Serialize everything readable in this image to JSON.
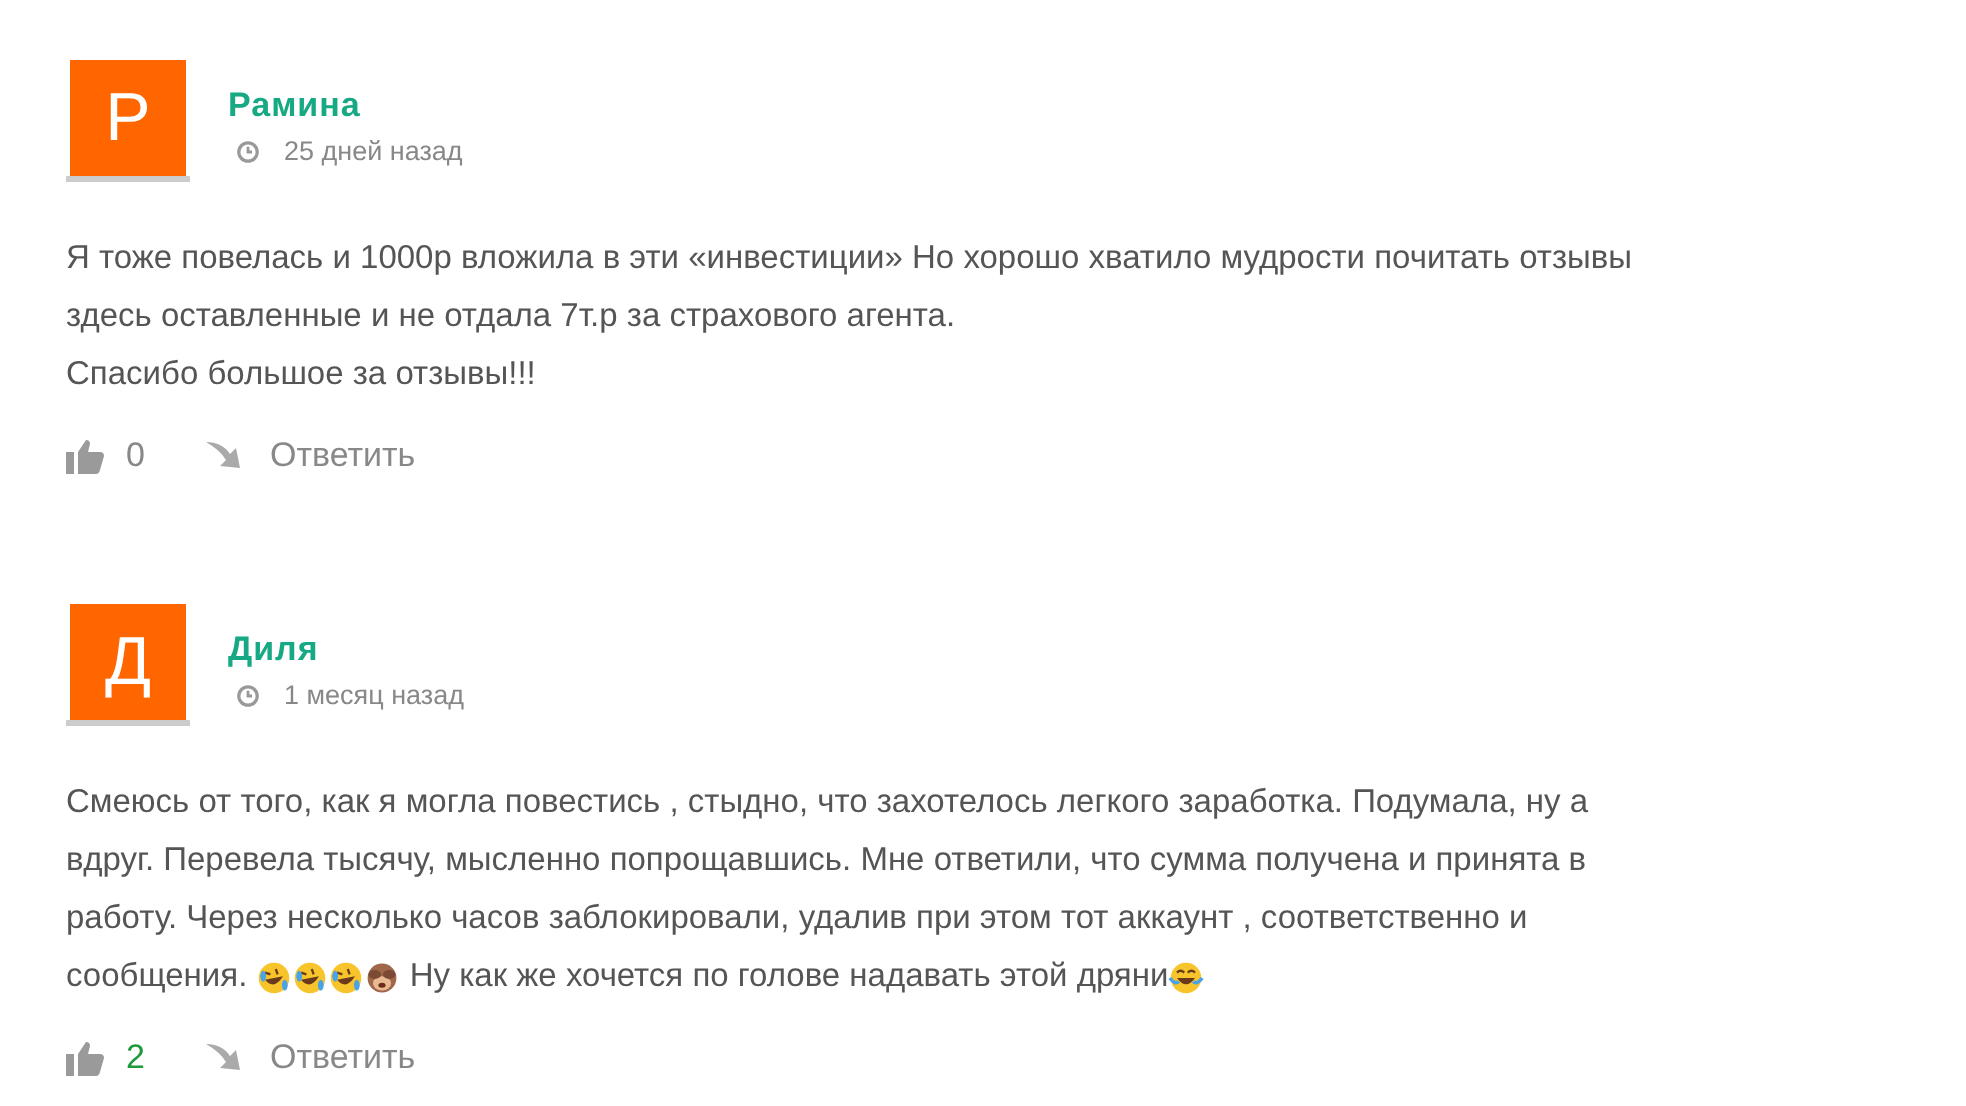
{
  "comments": [
    {
      "initial": "Р",
      "author": "Рамина",
      "date": "25 дней назад",
      "lines": [
        "Я тоже повелась и 1000р вложила в эти «инвестиции» Но хорошо хватило мудрости почитать отзывы",
        "здесь оставленные и не отдала 7т.р за страхового агента.",
        "Спасибо большое за отзывы!!!"
      ],
      "likes": {
        "count": "0",
        "color": "#888888"
      },
      "reply": "Ответить"
    },
    {
      "initial": "Д",
      "author": "Диля",
      "date": "1 месяц назад",
      "lines": [
        "Смеюсь от того, как я могла повестись , стыдно, что захотелось легкого заработка. Подумала, ну а",
        "вдруг. Перевела тысячу, мысленно попрощавшись. Мне ответили, что сумма получена и принята в",
        "работу. Через несколько часов заблокировали, удалив при этом тот аккаунт , соответственно и",
        [
          {
            "kind": "text",
            "value": "сообщения. "
          },
          {
            "kind": "rofl"
          },
          {
            "kind": "rofl"
          },
          {
            "kind": "rofl"
          },
          {
            "kind": "monkey"
          },
          {
            "kind": "text",
            "value": " Ну как же хочется по голове надавать этой дряни"
          },
          {
            "kind": "tears"
          }
        ]
      ],
      "likes": {
        "count": "2",
        "color": "#1c9a3c"
      },
      "reply": "Ответить"
    }
  ]
}
